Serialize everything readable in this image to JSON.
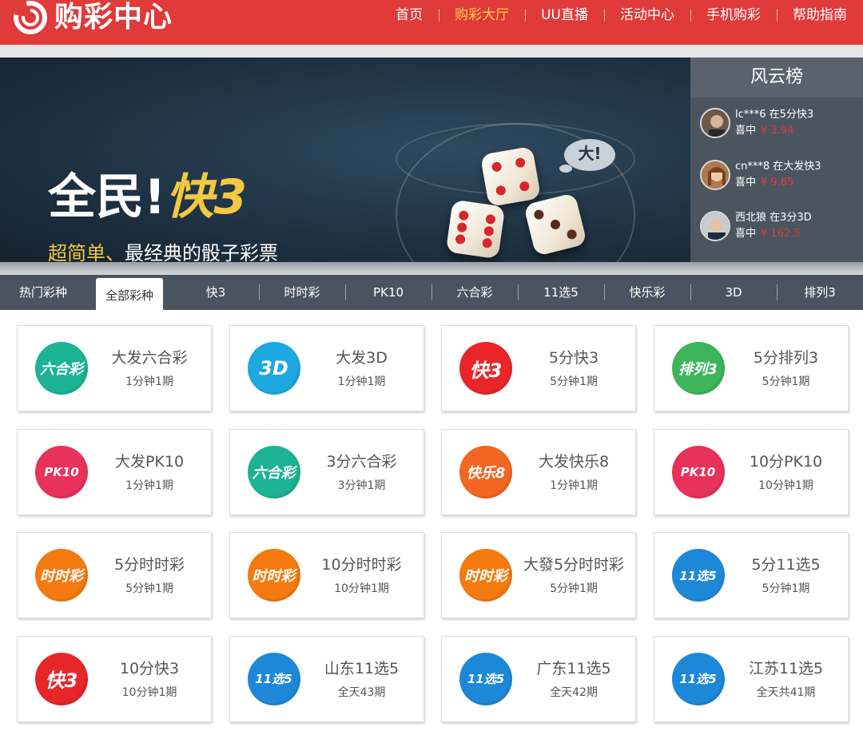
{
  "header": {
    "logo_text": "购彩中心",
    "nav": [
      {
        "label": "首页",
        "active": false
      },
      {
        "label": "购彩大厅",
        "active": true
      },
      {
        "label": "UU直播",
        "active": false
      },
      {
        "label": "活动中心",
        "active": false
      },
      {
        "label": "手机购彩",
        "active": false
      },
      {
        "label": "帮助指南",
        "active": false
      }
    ]
  },
  "banner": {
    "title_main": "全民!",
    "title_accent": "快3",
    "subtitle_accent": "超简单、",
    "subtitle_rest": "最经典的骰子彩票",
    "bubble_text": "大!",
    "slide_count": 2,
    "active_slide": 2
  },
  "leaderboard": {
    "title": "风云榜",
    "winners": [
      {
        "user": "lc***6 在5分快3",
        "won_label": "喜中",
        "amount": "¥ 3.94"
      },
      {
        "user": "cn***8 在大发快3",
        "won_label": "喜中",
        "amount": "¥ 9.85"
      },
      {
        "user": "西北狼 在3分3D",
        "won_label": "喜中",
        "amount": "¥ 162.5"
      }
    ]
  },
  "tabs": [
    {
      "label": "热门彩种",
      "active": false
    },
    {
      "label": "全部彩种",
      "active": true
    },
    {
      "label": "快3",
      "active": false
    },
    {
      "label": "时时彩",
      "active": false
    },
    {
      "label": "PK10",
      "active": false
    },
    {
      "label": "六合彩",
      "active": false
    },
    {
      "label": "11选5",
      "active": false
    },
    {
      "label": "快乐彩",
      "active": false
    },
    {
      "label": "3D",
      "active": false
    },
    {
      "label": "排列3",
      "active": false
    }
  ],
  "games": [
    {
      "name": "大发六合彩",
      "freq": "1分钟1期",
      "icon": "liuhecai-icon",
      "icon_text": "六合彩",
      "color": "#1bb394"
    },
    {
      "name": "大发3D",
      "freq": "1分钟1期",
      "icon": "3d-icon",
      "icon_text": "3D",
      "color": "#1ea8e0"
    },
    {
      "name": "5分快3",
      "freq": "5分钟1期",
      "icon": "kuai3-icon",
      "icon_text": "快3",
      "color": "#e8262a"
    },
    {
      "name": "5分排列3",
      "freq": "5分钟1期",
      "icon": "pailie3-icon",
      "icon_text": "排列3",
      "color": "#3cb55a"
    },
    {
      "name": "大发PK10",
      "freq": "1分钟1期",
      "icon": "pk10-icon",
      "icon_text": "PK10",
      "color": "#e8325a"
    },
    {
      "name": "3分六合彩",
      "freq": "3分钟1期",
      "icon": "liuhecai-icon",
      "icon_text": "六合彩",
      "color": "#1bb394"
    },
    {
      "name": "大发快乐8",
      "freq": "1分钟1期",
      "icon": "kuaile8-icon",
      "icon_text": "快乐8",
      "color": "#f26522"
    },
    {
      "name": "10分PK10",
      "freq": "10分钟1期",
      "icon": "pk10-icon",
      "icon_text": "PK10",
      "color": "#e8325a"
    },
    {
      "name": "5分时时彩",
      "freq": "5分钟1期",
      "icon": "shishicai-icon",
      "icon_text": "时时彩",
      "color": "#f47a10"
    },
    {
      "name": "10分时时彩",
      "freq": "10分钟1期",
      "icon": "shishicai-icon",
      "icon_text": "时时彩",
      "color": "#f47a10"
    },
    {
      "name": "大發5分时时彩",
      "freq": "5分钟1期",
      "icon": "shishicai-icon",
      "icon_text": "时时彩",
      "color": "#f47a10"
    },
    {
      "name": "5分11选5",
      "freq": "5分钟1期",
      "icon": "11xuan5-icon",
      "icon_text": "11选5",
      "color": "#1e88d8"
    },
    {
      "name": "10分快3",
      "freq": "10分钟1期",
      "icon": "kuai3-icon",
      "icon_text": "快3",
      "color": "#e8262a"
    },
    {
      "name": "山东11选5",
      "freq": "全天43期",
      "icon": "11xuan5-icon",
      "icon_text": "11选5",
      "color": "#1e88d8"
    },
    {
      "name": "广东11选5",
      "freq": "全天42期",
      "icon": "11xuan5-icon",
      "icon_text": "11选5",
      "color": "#1e88d8"
    },
    {
      "name": "江苏11选5",
      "freq": "全天共41期",
      "icon": "11xuan5-icon",
      "icon_text": "11选5",
      "color": "#1e88d8"
    }
  ]
}
